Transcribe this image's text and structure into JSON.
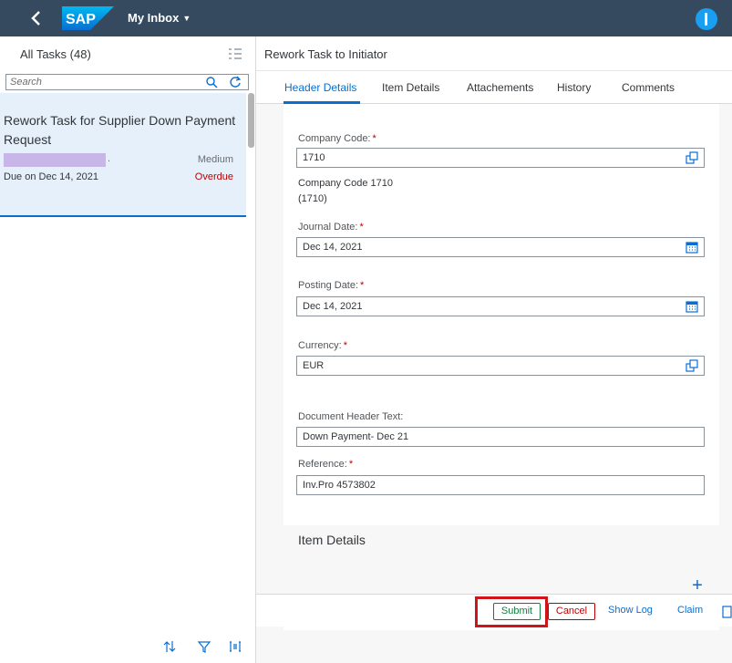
{
  "shell": {
    "logo_text": "SAP",
    "title": "My Inbox",
    "caret": "▼",
    "back_glyph": "‹"
  },
  "master": {
    "count_label": "All Tasks (48)",
    "search_placeholder": "Search",
    "task": {
      "title": "Rework Task for Supplier Down Payment Request",
      "redacted_suffix": ".",
      "priority": "Medium",
      "due": "Due on Dec 14, 2021",
      "status": "Overdue"
    },
    "footer_icons": [
      "sort-icon",
      "filter-icon",
      "group-icon"
    ]
  },
  "detail": {
    "title": "Rework Task to Initiator",
    "tabs": [
      {
        "label": "Header Details",
        "active": true
      },
      {
        "label": "Item Details",
        "active": false
      },
      {
        "label": "Attachements",
        "active": false
      },
      {
        "label": "History",
        "active": false
      },
      {
        "label": "Comments",
        "active": false
      }
    ],
    "form": {
      "company_code_label": "Company Code:",
      "company_code_value": "1710",
      "company_code_desc_line1": "Company Code 1710",
      "company_code_desc_line2": "(1710)",
      "journal_date_label": "Journal Date:",
      "journal_date_value": "Dec 14, 2021",
      "posting_date_label": "Posting Date:",
      "posting_date_value": "Dec 14, 2021",
      "currency_label": "Currency:",
      "currency_value": "EUR",
      "doc_header_label": "Document Header Text:",
      "doc_header_value": "Down Payment- Dec 21",
      "reference_label": "Reference:",
      "reference_value": "Inv.Pro 4573802",
      "required_marker": "*"
    },
    "item_details_heading": "Item Details",
    "add_glyph": "+"
  },
  "footer": {
    "submit": "Submit",
    "cancel": "Cancel",
    "show_log": "Show Log",
    "claim": "Claim"
  },
  "colors": {
    "shell_bg": "#354a5f",
    "accent": "#0a6ed1",
    "positive": "#107e3e",
    "negative": "#bb0000",
    "highlight": "#d0141c"
  }
}
